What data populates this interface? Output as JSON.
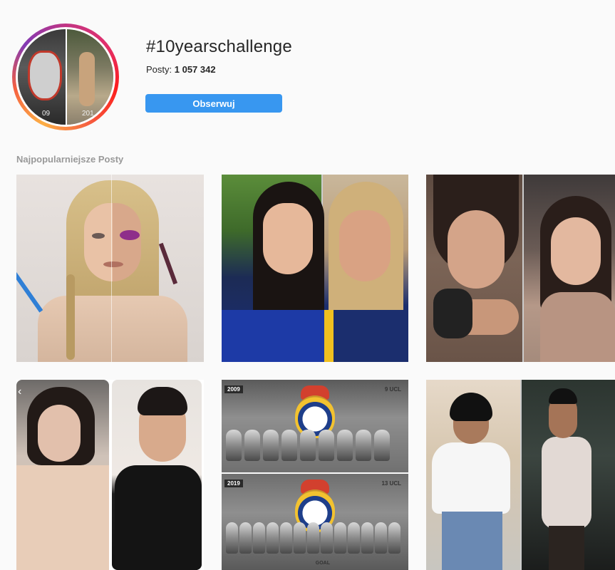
{
  "header": {
    "title": "#10yearschallenge",
    "posts_label": "Posty:",
    "posts_count": "1 057 342",
    "follow_label": "Obserwuj",
    "avatar_year_left": "09",
    "avatar_year_right": "201"
  },
  "section": {
    "top_posts_label": "Najpopularniejsze Posty"
  },
  "posts": [
    {
      "label": ""
    },
    {
      "label": ""
    },
    {
      "label": ""
    },
    {
      "label": ""
    },
    {
      "label": "",
      "year_top": "2009",
      "ucl_top": "9 UCL",
      "year_bottom": "2019",
      "ucl_bottom": "13 UCL",
      "watermark": "GOAL"
    },
    {
      "label": ""
    }
  ],
  "colors": {
    "follow_button": "#3897f0",
    "background": "#fafafa",
    "ring_gradient": [
      "#c13584",
      "#e1306c",
      "#fd1d1d",
      "#f56040",
      "#fcaf45"
    ]
  }
}
